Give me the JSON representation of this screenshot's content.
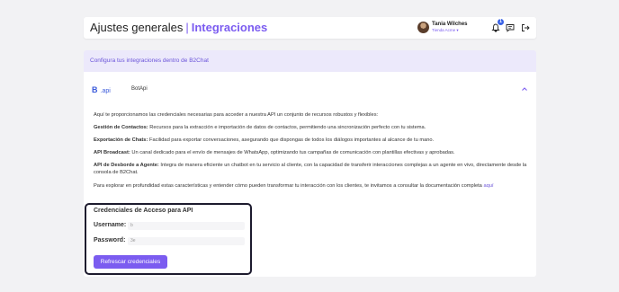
{
  "header": {
    "title": "Ajustes generales",
    "separator": "|",
    "subtitle": "Integraciones",
    "user_name": "Tania Wilches",
    "user_store": "Tienda Acme",
    "notification_count": "1",
    "icons": [
      "bell-icon",
      "chat-icon",
      "logout-icon"
    ]
  },
  "banner": {
    "text": "Configura tus integraciones dentro de B2Chat"
  },
  "integration": {
    "logo_b": "B",
    "logo_api": ".api",
    "name": "BotApi",
    "intro": "Aquí te proporcionamos las credenciales necesarias para acceder a nuestra API un conjunto de recursos robustos y flexibles:",
    "features": [
      {
        "title": "Gestión de Contactos:",
        "text": "Recursos para la extracción e importación de datos de contactos, permitiendo una sincronización perfecto con tu sistema."
      },
      {
        "title": "Exportación de Chats:",
        "text": "Facilidad para exportar conversaciones, asegurando que dispongas de todos los diálogos importantes al alcance de tu mano."
      },
      {
        "title": "API Broadcast:",
        "text": "Un canal dedicado para el envío de mensajes de WhatsApp, optimizando tus campañas de comunicación con plantillas efectivas y aprobadas."
      },
      {
        "title": "API de Desborde a Agente:",
        "text": "Integra de manera eficiente un chatbot en tu servicio al cliente, con la capacidad de transferir interacciones complejas a un agente en vivo, directamente desde la consola de B2Chat."
      }
    ],
    "outro": "Para explorar en profundidad estas características y entender cómo pueden transformar tu interacción con los clientes, te invitamos a consultar la documentación completa",
    "outro_link": "aquí"
  },
  "credentials": {
    "title": "Credenciales de Acceso para API",
    "username_label": "Username:",
    "username_value": "b",
    "password_label": "Password:",
    "password_value": "3e",
    "refresh_button": "Refrescar credenciales"
  }
}
